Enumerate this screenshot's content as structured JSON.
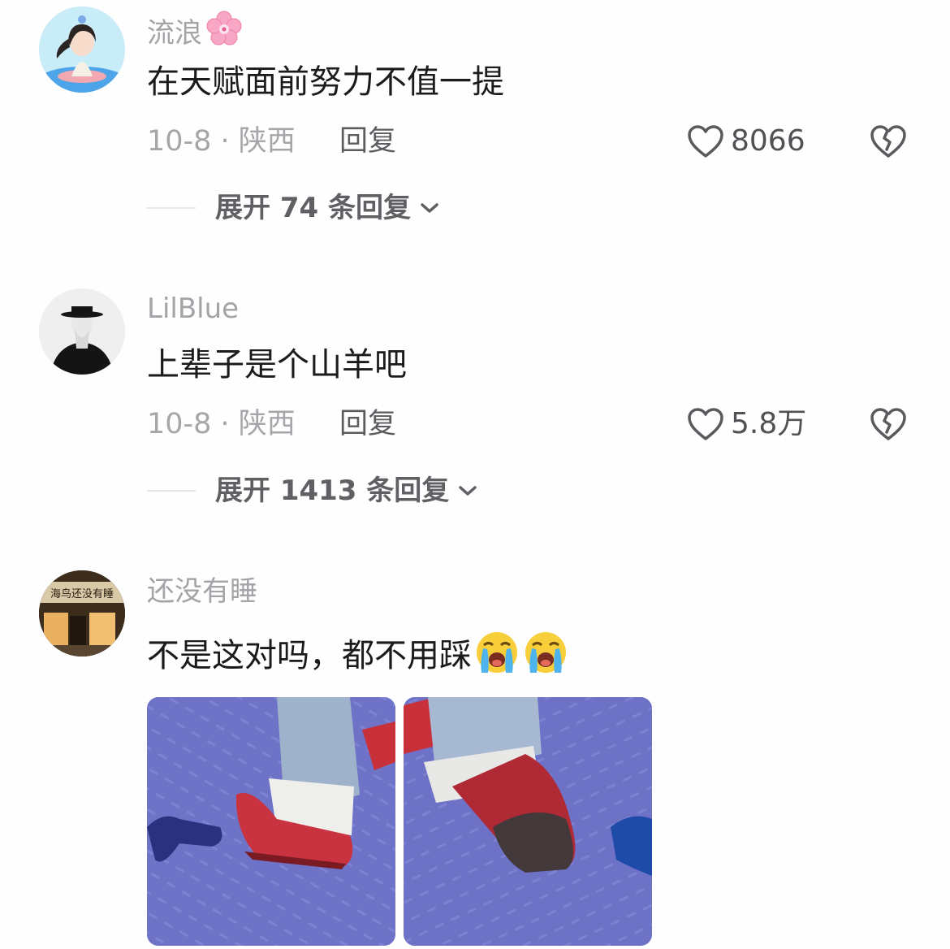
{
  "comments": [
    {
      "username": "流浪",
      "text": "在天赋面前努力不值一提",
      "meta": "10-8 · 陕西",
      "reply_label": "回复",
      "likes": "8066",
      "expand_label": "展开 74 条回复"
    },
    {
      "username": "LilBlue",
      "text": "上辈子是个山羊吧",
      "meta": "10-8 · 陕西",
      "reply_label": "回复",
      "likes": "5.8万",
      "expand_label": "展开 1413 条回复"
    },
    {
      "username": "还没有睡",
      "text": "不是这对吗，都不用踩",
      "avatar_sign_text": "海鸟还没有睡"
    }
  ],
  "icons": {
    "like": "heart-outline-icon",
    "dislike": "broken-heart-icon",
    "expand": "chevron-down-icon",
    "flower": "cherry-blossom-emoji",
    "crying": "loudly-crying-face-emoji"
  },
  "colors": {
    "username": "#a3a3a8",
    "text": "#1b1b1d",
    "meta": "#a6a6aa",
    "accent_floor": "#6f74c9"
  }
}
